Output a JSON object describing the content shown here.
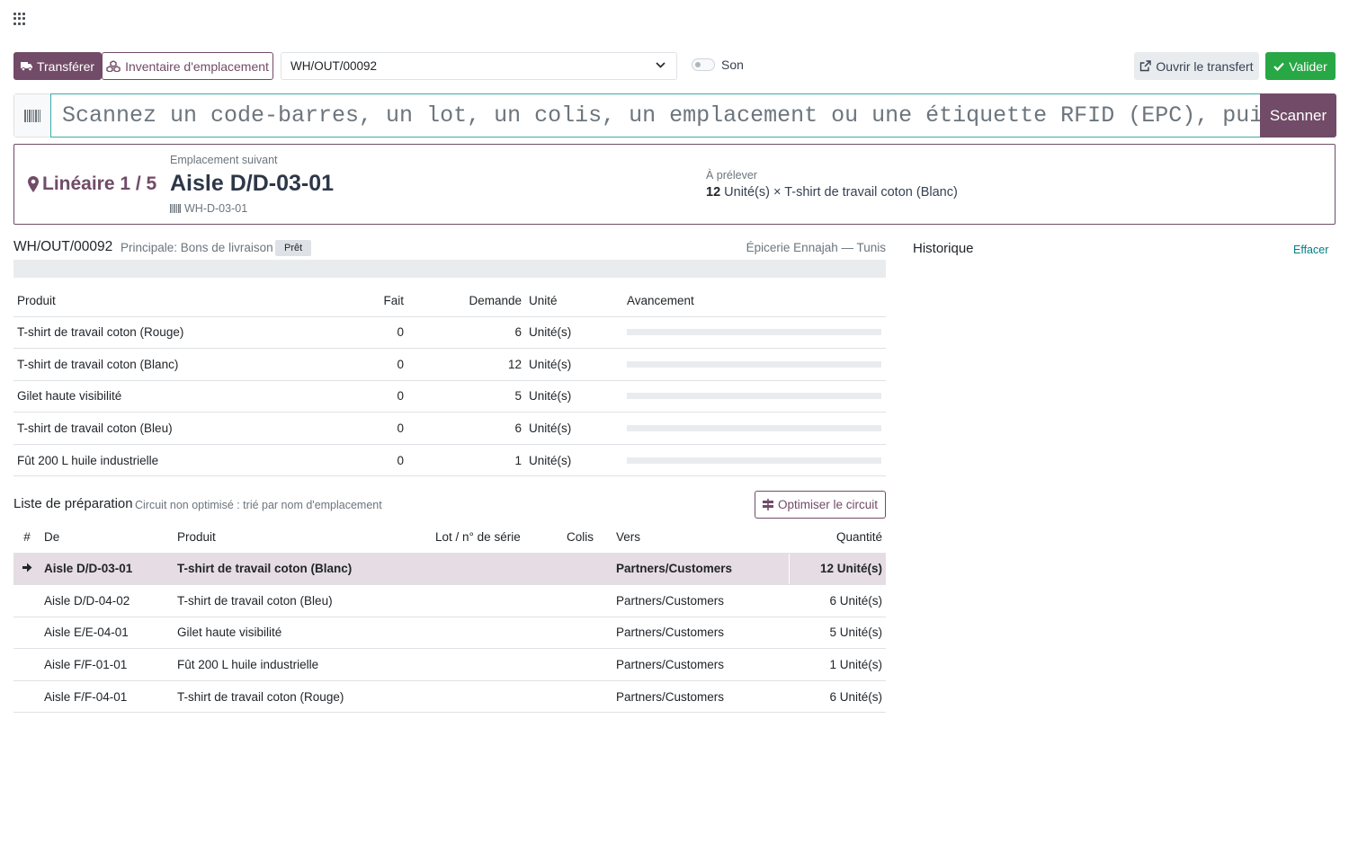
{
  "toolbar": {
    "transfer_label": "Transférer",
    "inventory_label": "Inventaire d'emplacement",
    "operation_value": "WH/OUT/00092",
    "sound_label": "Son",
    "open_transfer_label": "Ouvrir le transfert",
    "validate_label": "Valider"
  },
  "scanner": {
    "placeholder": "Scannez un code-barres, un lot, un colis, un emplacement ou une étiquette RFID (EPC), puis E",
    "scan_button": "Scanner"
  },
  "next_location": {
    "lineaire": "Linéaire 1 / 5",
    "label": "Emplacement suivant",
    "name": "Aisle D/D-03-01",
    "barcode": "WH-D-03-01",
    "pick_label": "À prélever",
    "pick_qty": "12",
    "pick_text": "Unité(s) × T-shirt de travail coton (Blanc)"
  },
  "document": {
    "reference": "WH/OUT/00092",
    "type": "Principale: Bons de livraison",
    "status": "Prêt",
    "partner": "Épicerie Ennajah — Tunis",
    "progress": 0
  },
  "moves": {
    "headers": {
      "product": "Produit",
      "done": "Fait",
      "demand": "Demande",
      "unit": "Unité",
      "progress": "Avancement"
    },
    "rows": [
      {
        "product": "T-shirt de travail coton (Rouge)",
        "done": "0",
        "demand": "6",
        "unit": "Unité(s)",
        "progress": 0
      },
      {
        "product": "T-shirt de travail coton (Blanc)",
        "done": "0",
        "demand": "12",
        "unit": "Unité(s)",
        "progress": 0
      },
      {
        "product": "Gilet haute visibilité",
        "done": "0",
        "demand": "5",
        "unit": "Unité(s)",
        "progress": 0
      },
      {
        "product": "T-shirt de travail coton (Bleu)",
        "done": "0",
        "demand": "6",
        "unit": "Unité(s)",
        "progress": 0
      },
      {
        "product": "Fût 200 L huile industrielle",
        "done": "0",
        "demand": "1",
        "unit": "Unité(s)",
        "progress": 0
      }
    ]
  },
  "picking": {
    "title": "Liste de préparation",
    "subtitle": "Circuit non optimisé : trié par nom d'emplacement",
    "optimize_label": "Optimiser le circuit",
    "headers": {
      "num": "#",
      "from": "De",
      "product": "Produit",
      "lot": "Lot / n° de série",
      "package": "Colis",
      "to": "Vers",
      "quantity": "Quantité"
    },
    "rows": [
      {
        "from": "Aisle D/D-03-01",
        "product": "T-shirt de travail coton (Blanc)",
        "lot": "",
        "package": "",
        "to": "Partners/Customers",
        "quantity": "12 Unité(s)",
        "current": true
      },
      {
        "from": "Aisle D/D-04-02",
        "product": "T-shirt de travail coton (Bleu)",
        "lot": "",
        "package": "",
        "to": "Partners/Customers",
        "quantity": "6 Unité(s)",
        "current": false
      },
      {
        "from": "Aisle E/E-04-01",
        "product": "Gilet haute visibilité",
        "lot": "",
        "package": "",
        "to": "Partners/Customers",
        "quantity": "5 Unité(s)",
        "current": false
      },
      {
        "from": "Aisle F/F-01-01",
        "product": "Fût 200 L huile industrielle",
        "lot": "",
        "package": "",
        "to": "Partners/Customers",
        "quantity": "1 Unité(s)",
        "current": false
      },
      {
        "from": "Aisle F/F-04-01",
        "product": "T-shirt de travail coton (Rouge)",
        "lot": "",
        "package": "",
        "to": "Partners/Customers",
        "quantity": "6 Unité(s)",
        "current": false
      }
    ]
  },
  "history": {
    "title": "Historique",
    "clear_label": "Effacer"
  },
  "colors": {
    "primary": "#714b67",
    "success": "#28a745",
    "link": "#017e84",
    "highlight_row": "#e6dce3"
  },
  "icons": {
    "apps": "apps-grid-icon",
    "transfer": "truck-icon",
    "inventory": "cubes-icon",
    "barcode": "barcode-icon",
    "pin": "map-marker-icon",
    "open": "external-link-icon",
    "validate": "check-icon",
    "optimize": "route-icon",
    "current": "arrow-right-icon"
  }
}
